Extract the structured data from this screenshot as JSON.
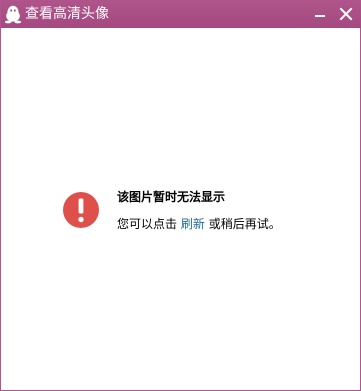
{
  "window": {
    "title": "查看高清头像",
    "accent_color": "#aa4f85",
    "icons": {
      "app": "qq-penguin-icon",
      "minimize": "minimize-icon",
      "close": "close-icon",
      "alert": "alert-exclamation-icon"
    }
  },
  "message": {
    "title": "该图片暂时无法显示",
    "prefix": "您可以点击",
    "link": "刷新",
    "suffix": "或稍后再试。",
    "alert_color": "#e0504b",
    "link_color": "#1c6ba0"
  }
}
